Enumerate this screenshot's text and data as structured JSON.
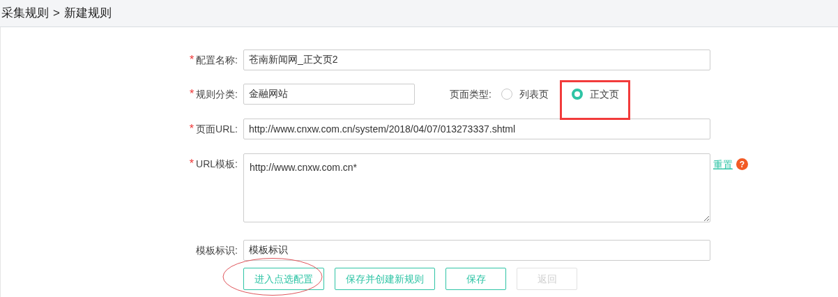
{
  "breadcrumb": [
    {
      "label": "采集规则"
    },
    {
      "label": ">"
    },
    {
      "label": "新建规则"
    }
  ],
  "form": {
    "name": {
      "label": "配置名称:",
      "required_mark": "*",
      "value": "苍南新闻网_正文页2"
    },
    "category": {
      "label": "规则分类:",
      "required_mark": "*",
      "value": "金融网站"
    },
    "page_type": {
      "label": "页面类型:",
      "options": [
        {
          "label": "列表页",
          "selected": false
        },
        {
          "label": "正文页",
          "selected": true
        }
      ]
    },
    "page_url": {
      "label": "页面URL:",
      "required_mark": "*",
      "value": "http://www.cnxw.com.cn/system/2018/04/07/013273337.shtml"
    },
    "url_template": {
      "label": "URL模板:",
      "required_mark": "*",
      "value": "http://www.cnxw.com.cn*",
      "reset_link": "重置",
      "help_icon": "?"
    },
    "template_tag": {
      "label": "模板标识:",
      "value": "模板标识"
    }
  },
  "buttons": [
    {
      "label": "进入点选配置",
      "disabled": false
    },
    {
      "label": "保存并创建新规则",
      "disabled": false
    },
    {
      "label": "保存",
      "disabled": false
    },
    {
      "label": "返回",
      "disabled": true
    }
  ]
}
